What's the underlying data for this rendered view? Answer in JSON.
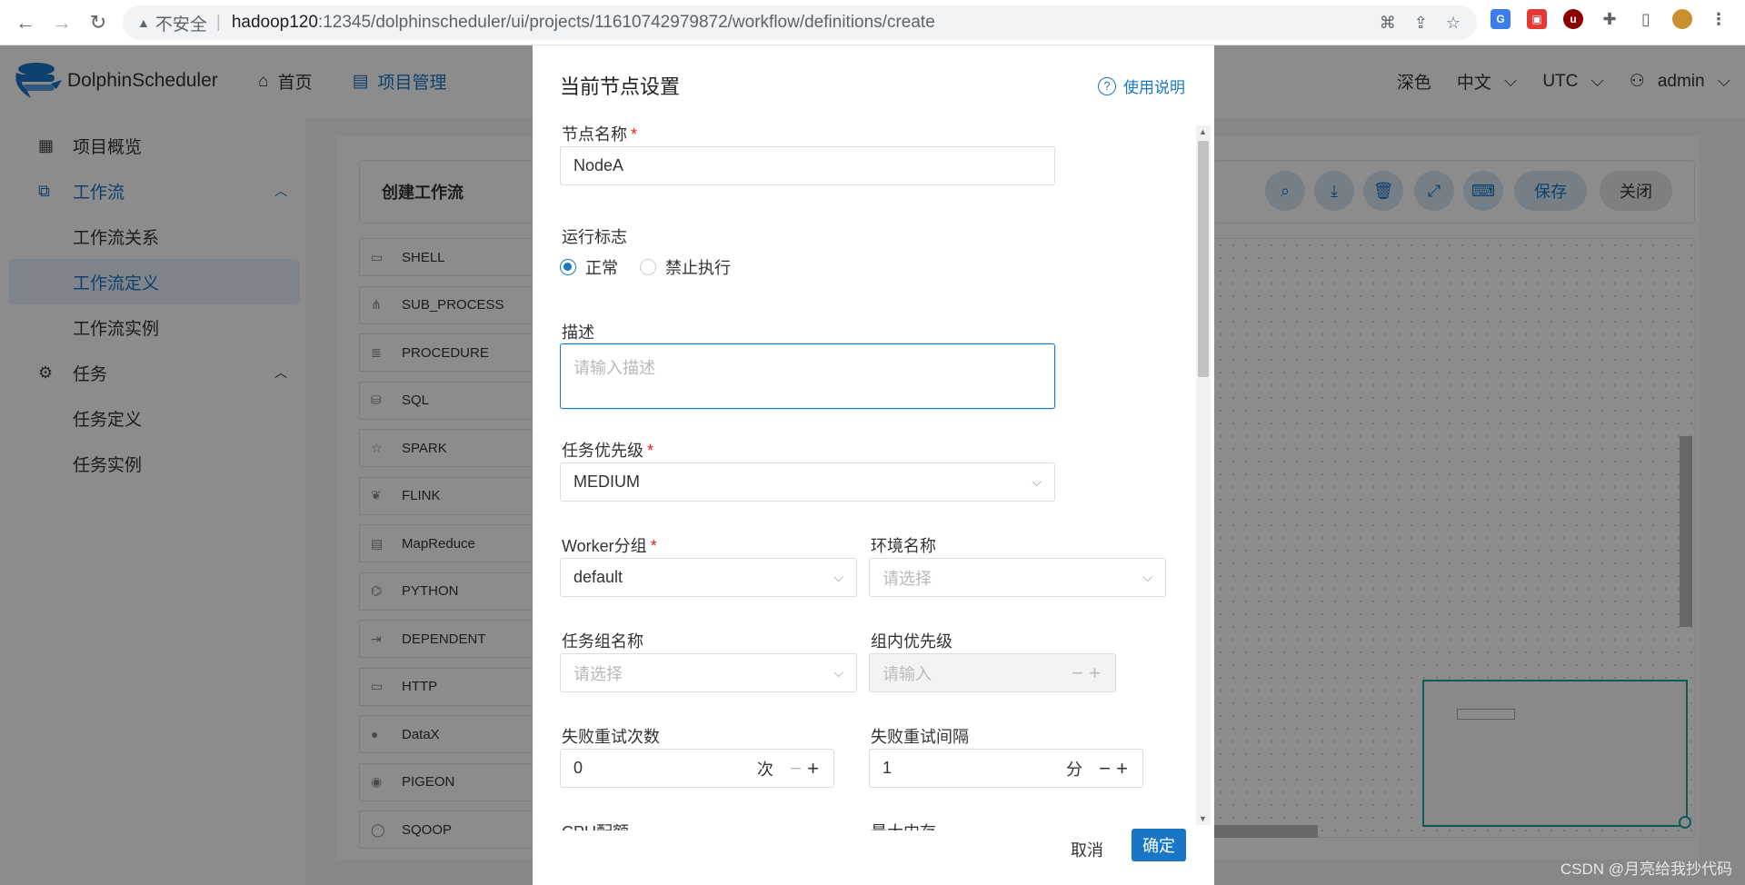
{
  "browser": {
    "insecure_label": "不安全",
    "url_host": "hadoop120",
    "url_path": ":12345/dolphinscheduler/ui/projects/11610742979872/workflow/definitions/create"
  },
  "header": {
    "logo_text": "DolphinScheduler",
    "nav": [
      {
        "label": "首页",
        "icon": "home-icon"
      },
      {
        "label": "项目管理",
        "icon": "project-icon"
      }
    ],
    "theme_label": "深色",
    "language_label": "中文",
    "timezone_label": "UTC",
    "user_label": "admin"
  },
  "sidebar": {
    "items": [
      {
        "label": "项目概览"
      },
      {
        "label": "工作流"
      },
      {
        "label": "工作流关系"
      },
      {
        "label": "工作流定义"
      },
      {
        "label": "工作流实例"
      },
      {
        "label": "任务"
      },
      {
        "label": "任务定义"
      },
      {
        "label": "任务实例"
      }
    ]
  },
  "workflow": {
    "title": "创建工作流",
    "save_label": "保存",
    "close_label": "关闭",
    "tasks": [
      "SHELL",
      "SUB_PROCESS",
      "PROCEDURE",
      "SQL",
      "SPARK",
      "FLINK",
      "MapReduce",
      "PYTHON",
      "DEPENDENT",
      "HTTP",
      "DataX",
      "PIGEON",
      "SQOOP"
    ]
  },
  "modal": {
    "title": "当前节点设置",
    "help_label": "使用说明",
    "node_name_label": "节点名称",
    "node_name_value": "NodeA",
    "run_flag_label": "运行标志",
    "run_flag_normal": "正常",
    "run_flag_forbidden": "禁止执行",
    "description_label": "描述",
    "description_placeholder": "请输入描述",
    "priority_label": "任务优先级",
    "priority_value": "MEDIUM",
    "worker_group_label": "Worker分组",
    "worker_group_value": "default",
    "environment_label": "环境名称",
    "environment_placeholder": "请选择",
    "task_group_label": "任务组名称",
    "task_group_placeholder": "请选择",
    "group_priority_label": "组内优先级",
    "group_priority_placeholder": "请输入",
    "retry_times_label": "失败重试次数",
    "retry_times_value": "0",
    "retry_times_unit": "次",
    "retry_interval_label": "失败重试间隔",
    "retry_interval_value": "1",
    "retry_interval_unit": "分",
    "cpu_quota_label": "CPU配额",
    "max_memory_label": "最大内存",
    "cancel_label": "取消",
    "confirm_label": "确定"
  },
  "watermark": "CSDN @月亮给我抄代码",
  "colors": {
    "accent": "#1976c6",
    "required": "#e02020",
    "minimap_border": "#1aa79a"
  }
}
